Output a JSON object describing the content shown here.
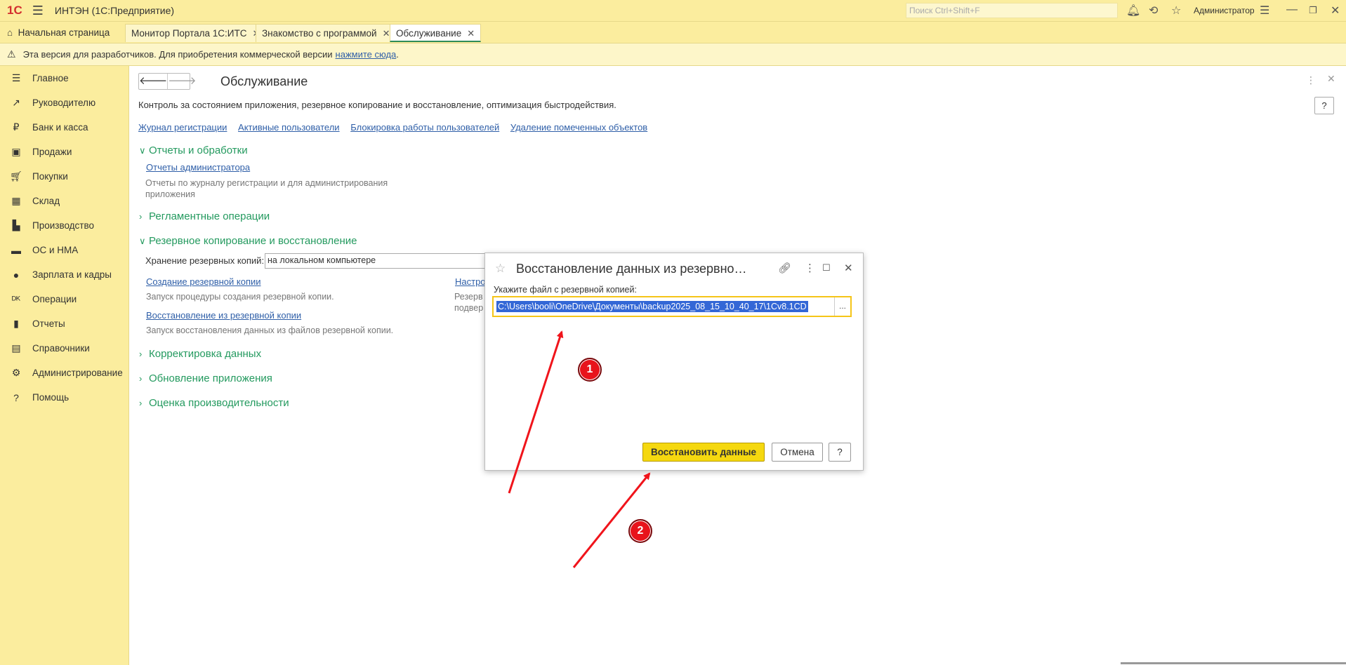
{
  "topbar": {
    "logo": "1С",
    "title": "ИНТЭН  (1С:Предприятие)",
    "search_placeholder": "Поиск Ctrl+Shift+F",
    "user": "Администратор"
  },
  "tabs": [
    {
      "label": "Начальная страница"
    },
    {
      "label": "Монитор Портала 1С:ИТС"
    },
    {
      "label": "Знакомство с программой"
    },
    {
      "label": "Обслуживание"
    }
  ],
  "notice": {
    "text": "Эта версия для разработчиков. Для приобретения коммерческой версии",
    "link": "нажмите сюда",
    "tail": "."
  },
  "sidebar": {
    "items": [
      {
        "label": "Главное",
        "icon": "menu-icon"
      },
      {
        "label": "Руководителю",
        "icon": "trend-icon"
      },
      {
        "label": "Банк и касса",
        "icon": "ruble-icon"
      },
      {
        "label": "Продажи",
        "icon": "bag-icon"
      },
      {
        "label": "Покупки",
        "icon": "cart-icon"
      },
      {
        "label": "Склад",
        "icon": "grid-icon"
      },
      {
        "label": "Производство",
        "icon": "factory-icon"
      },
      {
        "label": "ОС и НМА",
        "icon": "truck-icon"
      },
      {
        "label": "Зарплата и кадры",
        "icon": "person-icon"
      },
      {
        "label": "Операции",
        "icon": "dt-kt-icon"
      },
      {
        "label": "Отчеты",
        "icon": "bar-chart-icon"
      },
      {
        "label": "Справочники",
        "icon": "books-icon"
      },
      {
        "label": "Администрирование",
        "icon": "gear-icon"
      },
      {
        "label": "Помощь",
        "icon": "question-icon"
      }
    ]
  },
  "main": {
    "title": "Обслуживание",
    "description": "Контроль за состоянием приложения, резервное копирование и восстановление, оптимизация быстродействия.",
    "help": "?",
    "links": [
      "Журнал регистрации",
      "Активные пользователи",
      "Блокировка работы пользователей",
      "Удаление помеченных объектов"
    ],
    "sections": {
      "reports": {
        "title": "Отчеты и обработки",
        "link": "Отчеты администратора",
        "desc1": "Отчеты по журналу регистрации и для администрирования",
        "desc2": "приложения"
      },
      "routine": {
        "title": "Регламентные операции"
      },
      "backup": {
        "title": "Резервное копирование и восстановление",
        "storage_label": "Хранение резервных копий:",
        "storage_value": "на локальном компьютере",
        "create_link": "Создание резервной копии",
        "create_desc": "Запуск процедуры создания резервной копии.",
        "restore_link": "Восстановление из резервной копии",
        "restore_desc": "Запуск восстановления данных из файлов резервной копии.",
        "settings_link": "Настро",
        "settings_desc1": "Резерв",
        "settings_desc2": "подвер"
      },
      "correction": {
        "title": "Корректировка данных"
      },
      "update": {
        "title": "Обновление приложения"
      },
      "performance": {
        "title": "Оценка производительности"
      }
    }
  },
  "dialog": {
    "title": "Восстановление данных из резервно…",
    "label": "Укажите файл с резервной копией:",
    "file_path": "C:\\Users\\booli\\OneDrive\\Документы\\backup2025_08_15_10_40_17\\1Cv8.1CD",
    "browse": "...",
    "restore_button": "Восстановить данные",
    "cancel_button": "Отмена",
    "help_button": "?"
  },
  "annotations": {
    "badge1": "1",
    "badge2": "2",
    "arrow_color": "#f0141b"
  }
}
